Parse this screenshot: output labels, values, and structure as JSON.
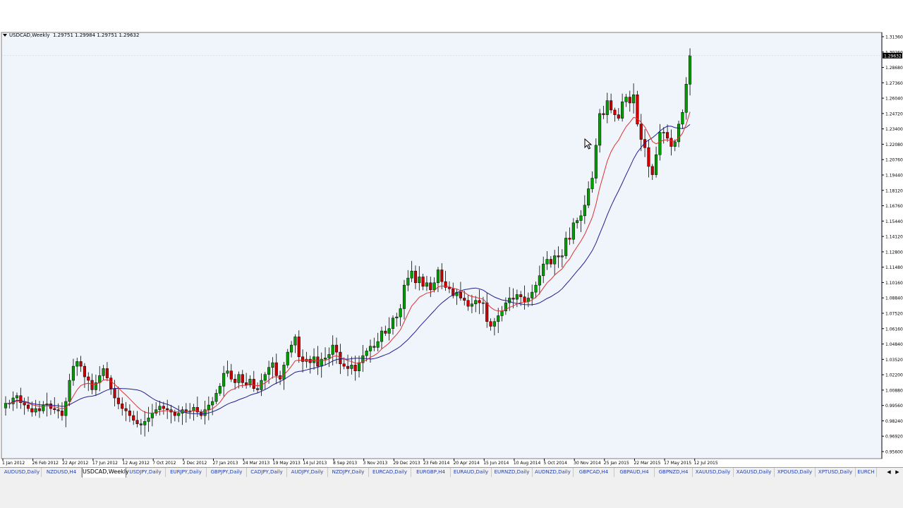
{
  "chart_info": {
    "symbol": "USDCAD,Weekly",
    "ohlc": "1.29751 1.29984 1.29751 1.29632"
  },
  "current_price": "1.29632",
  "tabs": [
    "AUDUSD,Daily",
    "NZDUSD,H4",
    "USDCAD,Weekly",
    "USDJPY,Daily",
    "EURJPY,Daily",
    "GBPJPY,Daily",
    "CADJPY,Daily",
    "AUDJPY,Daily",
    "NZDJPY,Daily",
    "EURCAD,Daily",
    "EURGBP,H4",
    "EURAUD,Daily",
    "EURNZD,Daily",
    "AUDNZD,Daily",
    "GBPCAD,H4",
    "GBPAUD,H4",
    "GBPNZD,H4",
    "XAUUSD,Daily",
    "XAGUSD,Daily",
    "XPDUSD,Daily",
    "XPTUSD,Daily",
    "EURCH"
  ],
  "active_tab": 2,
  "colors": {
    "background": "#f0f5fb",
    "bull": "#00a000",
    "bear": "#cc0000",
    "ma_fast": "#e03030",
    "ma_slow": "#202090"
  },
  "chart_data": {
    "type": "candlestick",
    "symbol": "USDCAD",
    "timeframe": "Weekly",
    "ylim": [
      0.9558,
      1.3136
    ],
    "y_ticks": [
      "1.31360",
      "1.30260",
      "1.28680",
      "1.27360",
      "1.26040",
      "1.24720",
      "1.23400",
      "1.22080",
      "1.20760",
      "1.19440",
      "1.18120",
      "1.16760",
      "1.15440",
      "1.14120",
      "1.12800",
      "1.11480",
      "1.10160",
      "1.08840",
      "1.07520",
      "1.06160",
      "1.04840",
      "1.03520",
      "1.02200",
      "1.00880",
      "0.99560",
      "0.98240",
      "0.96920",
      "0.95600"
    ],
    "x_ticks": [
      {
        "label": "1 Jan 2012",
        "bar": 0
      },
      {
        "label": "26 Feb 2012",
        "bar": 8
      },
      {
        "label": "22 Apr 2012",
        "bar": 16
      },
      {
        "label": "17 Jun 2012",
        "bar": 24
      },
      {
        "label": "12 Aug 2012",
        "bar": 32
      },
      {
        "label": "7 Oct 2012",
        "bar": 40
      },
      {
        "label": "2 Dec 2012",
        "bar": 48
      },
      {
        "label": "27 Jan 2013",
        "bar": 56
      },
      {
        "label": "24 Mar 2013",
        "bar": 64
      },
      {
        "label": "19 May 2013",
        "bar": 72
      },
      {
        "label": "14 Jul 2013",
        "bar": 80
      },
      {
        "label": "8 Sep 2013",
        "bar": 88
      },
      {
        "label": "3 Nov 2013",
        "bar": 96
      },
      {
        "label": "29 Dec 2013",
        "bar": 104
      },
      {
        "label": "23 Feb 2014",
        "bar": 112
      },
      {
        "label": "20 Apr 2014",
        "bar": 120
      },
      {
        "label": "15 Jun 2014",
        "bar": 128
      },
      {
        "label": "10 Aug 2014",
        "bar": 136
      },
      {
        "label": "5 Oct 2014",
        "bar": 144
      },
      {
        "label": "30 Nov 2014",
        "bar": 152
      },
      {
        "label": "25 Jan 2015",
        "bar": 160
      },
      {
        "label": "22 Mar 2015",
        "bar": 168
      },
      {
        "label": "17 May 2015",
        "bar": 176
      },
      {
        "label": "12 Jul 2015",
        "bar": 184
      }
    ],
    "closes": [
      1.0005,
      1.0,
      1.005,
      1.007,
      1.001,
      0.999,
      0.996,
      0.993,
      0.996,
      0.994,
      0.999,
      1.0,
      0.996,
      0.995,
      0.994,
      0.99,
      1.002,
      1.02,
      1.032,
      1.036,
      1.032,
      1.023,
      1.02,
      1.012,
      1.018,
      1.024,
      1.03,
      1.022,
      1.013,
      1.005,
      1.0,
      0.996,
      0.994,
      0.99,
      0.986,
      0.983,
      0.982,
      0.985,
      0.988,
      0.992,
      0.995,
      0.998,
      0.996,
      0.995,
      0.993,
      0.99,
      0.992,
      0.995,
      0.993,
      0.994,
      0.997,
      0.993,
      0.99,
      0.995,
      0.999,
      1.002,
      1.009,
      1.015,
      1.026,
      1.028,
      1.021,
      1.018,
      1.025,
      1.018,
      1.016,
      1.021,
      1.013,
      1.012,
      1.02,
      1.025,
      1.031,
      1.035,
      1.024,
      1.021,
      1.033,
      1.044,
      1.05,
      1.057,
      1.04,
      1.036,
      1.038,
      1.035,
      1.04,
      1.032,
      1.038,
      1.039,
      1.042,
      1.05,
      1.044,
      1.034,
      1.032,
      1.03,
      1.033,
      1.028,
      1.035,
      1.041,
      1.045,
      1.049,
      1.048,
      1.053,
      1.062,
      1.06,
      1.064,
      1.073,
      1.074,
      1.081,
      1.101,
      1.107,
      1.113,
      1.103,
      1.108,
      1.1,
      1.103,
      1.097,
      1.103,
      1.114,
      1.104,
      1.099,
      1.098,
      1.092,
      1.095,
      1.09,
      1.088,
      1.083,
      1.085,
      1.088,
      1.086,
      1.086,
      1.07,
      1.066,
      1.07,
      1.075,
      1.079,
      1.086,
      1.09,
      1.089,
      1.093,
      1.091,
      1.087,
      1.09,
      1.095,
      1.101,
      1.109,
      1.119,
      1.123,
      1.119,
      1.126,
      1.125,
      1.126,
      1.141,
      1.14,
      1.154,
      1.156,
      1.16,
      1.169,
      1.183,
      1.192,
      1.22,
      1.247,
      1.246,
      1.258,
      1.25,
      1.246,
      1.243,
      1.257,
      1.261,
      1.256,
      1.263,
      1.238,
      1.225,
      1.218,
      1.202,
      1.195,
      1.212,
      1.231,
      1.231,
      1.226,
      1.219,
      1.223,
      1.238,
      1.248,
      1.272,
      1.2963
    ]
  }
}
